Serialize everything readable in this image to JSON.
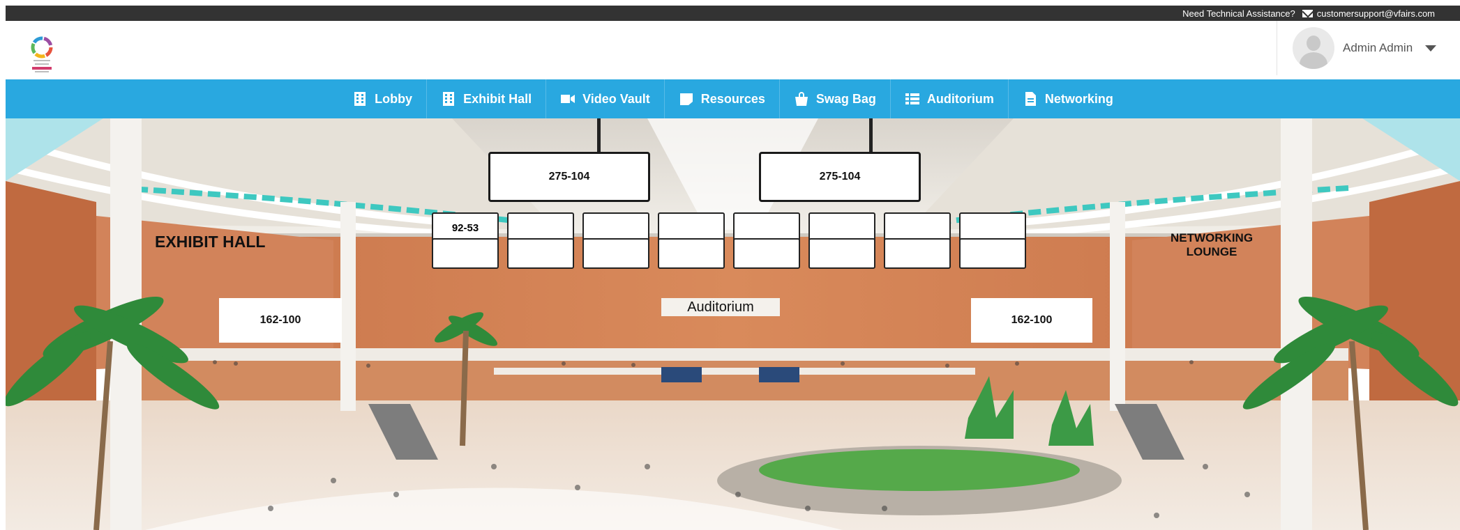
{
  "topbar": {
    "help_text": "Need Technical Assistance?",
    "email": "customersupport@vfairs.com",
    "mail_icon": "envelope-icon"
  },
  "header": {
    "logo_icon": "event-logo-mexico",
    "user_name": "Admin Admin",
    "user_dropdown_icon": "caret-down-icon"
  },
  "nav": {
    "items": [
      {
        "label": "Lobby",
        "icon": "building-icon"
      },
      {
        "label": "Exhibit Hall",
        "icon": "building-icon"
      },
      {
        "label": "Video Vault",
        "icon": "video-camera-icon"
      },
      {
        "label": "Resources",
        "icon": "file-icon"
      },
      {
        "label": "Swag Bag",
        "icon": "shopping-bag-icon"
      },
      {
        "label": "Auditorium",
        "icon": "list-icon"
      },
      {
        "label": "Networking",
        "icon": "document-icon"
      }
    ],
    "background_color": "#29a8e0"
  },
  "lobby": {
    "hanging_screens": [
      "275-104",
      "275-104"
    ],
    "wall_panel_first": "92-53",
    "exhibit_hall_sign": "EXHIBIT HALL",
    "networking_lounge_sign_line1": "NETWORKING",
    "networking_lounge_sign_line2": "LOUNGE",
    "auditorium_sign": "Auditorium",
    "banner_left": "162-100",
    "banner_right": "162-100"
  }
}
